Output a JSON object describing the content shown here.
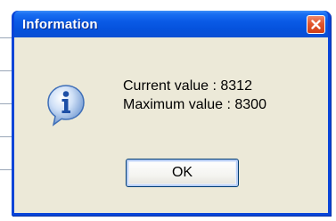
{
  "window": {
    "title": "Information",
    "close_icon": "close-icon"
  },
  "message": {
    "icon": "information-icon",
    "line1": "Current value : 8312",
    "line2": "Maximum value : 8300"
  },
  "buttons": {
    "ok_label": "OK"
  },
  "colors": {
    "titlebar": "#0552dc",
    "close_button": "#e2552d",
    "client_background": "#ece9d8",
    "button_border": "#003c74"
  }
}
